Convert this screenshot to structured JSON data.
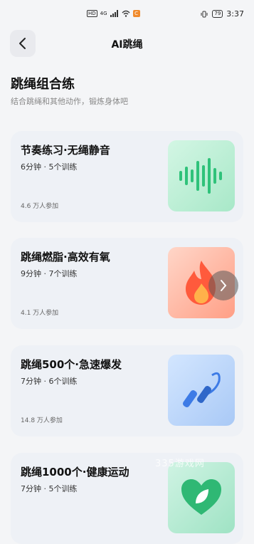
{
  "status": {
    "left_tag1": "HD",
    "left_tag2": "4G",
    "left_icon": "signal-icon",
    "battery": "79",
    "time": "3:37"
  },
  "header": {
    "title": "AI跳绳",
    "back_icon": "chevron-left-icon"
  },
  "section": {
    "title": "跳绳组合练",
    "subtitle": "结合跳绳和其他动作，锻炼身体吧"
  },
  "cards": [
    {
      "title": "节奏练习·无绳静音",
      "meta": "6分钟 · 5个训练",
      "count": "4.6 万人参加",
      "icon": "sound-wave-icon"
    },
    {
      "title": "跳绳燃脂·高效有氧",
      "meta": "9分钟 · 7个训练",
      "count": "4.1 万人参加",
      "icon": "flame-icon"
    },
    {
      "title": "跳绳500个·急速爆发",
      "meta": "7分钟 · 6个训练",
      "count": "14.8 万人参加",
      "icon": "jump-rope-icon"
    },
    {
      "title": "跳绳1000个·健康运动",
      "meta": "7分钟 · 5个训练",
      "count": "",
      "icon": "heart-leaf-icon"
    }
  ],
  "watermark": "335游戏网",
  "colors": {
    "accent_green": "#2fc27a",
    "flame": "#ff5a3c",
    "rope_blue": "#3d7be6"
  }
}
